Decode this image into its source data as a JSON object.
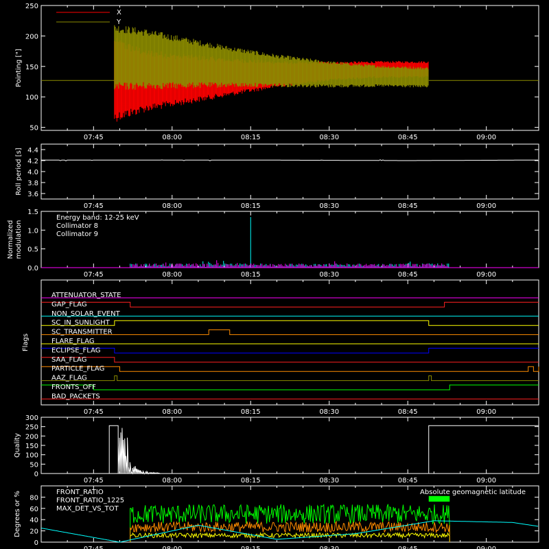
{
  "colors": {
    "background": "#000000",
    "axis": "#ffffff",
    "x": "#ff0000",
    "y": "#8c8c00",
    "white": "#ffffff",
    "cyan": "#00ffff",
    "magenta": "#ff00ff",
    "green": "#00ff00",
    "orange": "#ff8c00",
    "yellow": "#ffff00"
  },
  "time_axis": {
    "start": "07:35",
    "end": "09:10",
    "tick_labels": [
      "07:45",
      "08:00",
      "08:15",
      "08:30",
      "08:45",
      "09:00"
    ]
  },
  "chart_data": [
    {
      "id": "pointing",
      "type": "line",
      "ylabel": "Pointing [\"]",
      "ylim": [
        45,
        250
      ],
      "yticks": [
        50,
        100,
        150,
        200,
        250
      ],
      "grid": false,
      "legend_position": "top-left",
      "series": [
        {
          "name": "X",
          "color": "#ff0000",
          "x": [
            "07:49",
            "07:55",
            "08:00",
            "08:10",
            "08:20",
            "08:30",
            "08:40",
            "08:49"
          ],
          "center": [
            128,
            127,
            128,
            132,
            137,
            142,
            145,
            145
          ],
          "amplitude": [
            70,
            52,
            45,
            33,
            22,
            16,
            14,
            14
          ]
        },
        {
          "name": "Y",
          "color": "#8c8c00",
          "x": [
            "07:49",
            "07:55",
            "08:00",
            "08:10",
            "08:20",
            "08:30",
            "08:40",
            "08:49"
          ],
          "center": [
            165,
            162,
            158,
            150,
            143,
            137,
            134,
            132
          ],
          "amplitude": [
            55,
            50,
            45,
            35,
            27,
            22,
            18,
            17
          ]
        }
      ],
      "baseline_y": 127,
      "active_range": [
        "07:49",
        "08:49"
      ]
    },
    {
      "id": "roll_period",
      "type": "line",
      "ylabel": "Roll period [s]",
      "ylim": [
        3.5,
        4.5
      ],
      "yticks": [
        "3.6",
        "3.8",
        "4.0",
        "4.2",
        "4.4"
      ],
      "series": [
        {
          "x": [
            "07:35",
            "08:15",
            "08:45",
            "09:10"
          ],
          "y": [
            4.21,
            4.21,
            4.2,
            4.21
          ]
        }
      ]
    },
    {
      "id": "modulation",
      "type": "line",
      "ylabel": "Normalized modulation",
      "ylim": [
        0.0,
        1.5
      ],
      "yticks": [
        "0.0",
        "0.5",
        "1.0",
        "1.5"
      ],
      "legend": [
        "Energy band: 12-25 keV",
        "Collimator 8",
        "Collimator 9"
      ],
      "series": [
        {
          "name": "Collimator 8",
          "color": "#00ffff",
          "x_range": [
            "07:52",
            "08:53"
          ],
          "typical": 0.08,
          "spike": {
            "x": "08:15",
            "y": 1.35
          }
        },
        {
          "name": "Collimator 9",
          "color": "#ff00ff",
          "x_range": [
            "07:52",
            "08:53"
          ],
          "typical": 0.08
        }
      ]
    },
    {
      "id": "flags",
      "type": "line",
      "ylabel": "Flags",
      "series": [
        {
          "name": "ATTENUATOR_STATE",
          "color": "#ff00ff",
          "steps": []
        },
        {
          "name": "GAP_FLAG",
          "color": "#ff2020",
          "steps": [
            [
              "07:35",
              1
            ],
            [
              "07:52",
              0
            ],
            [
              "08:52",
              1
            ]
          ]
        },
        {
          "name": "NON_SOLAR_EVENT",
          "color": "#00ffff",
          "steps": []
        },
        {
          "name": "SC_IN_SUNLIGHT",
          "color": "#ffff00",
          "steps": [
            [
              "07:35",
              0
            ],
            [
              "07:49",
              1
            ],
            [
              "08:49",
              0
            ]
          ]
        },
        {
          "name": "SC_TRANSMITTER",
          "color": "#ff8c00",
          "steps": [
            [
              "07:35",
              0
            ],
            [
              "08:07",
              1
            ],
            [
              "08:11",
              0
            ]
          ]
        },
        {
          "name": "FLARE_FLAG",
          "color": "#ffff00",
          "steps": []
        },
        {
          "name": "ECLIPSE_FLAG",
          "color": "#0000ff",
          "steps": [
            [
              "07:35",
              1
            ],
            [
              "07:49",
              0
            ],
            [
              "08:49",
              1
            ]
          ]
        },
        {
          "name": "SAA_FLAG",
          "color": "#ff2020",
          "steps": [
            [
              "07:35",
              1
            ],
            [
              "07:49",
              0
            ]
          ]
        },
        {
          "name": "PARTICLE_FLAG",
          "color": "#ff8c00",
          "steps": [
            [
              "07:35",
              1
            ],
            [
              "07:50",
              0
            ],
            [
              "09:08",
              1
            ],
            [
              "09:09",
              0
            ],
            [
              "09:10",
              1
            ]
          ]
        },
        {
          "name": "AAZ_FLAG",
          "color": "#8c8c00",
          "steps": [
            [
              "07:35",
              0
            ],
            [
              "07:49",
              1
            ],
            [
              "07:49.5",
              0
            ],
            [
              "08:49",
              1
            ],
            [
              "08:49.5",
              0
            ]
          ]
        },
        {
          "name": "FRONTS_OFF",
          "color": "#00ff00",
          "steps": [
            [
              "07:35",
              1
            ],
            [
              "07:45",
              0
            ],
            [
              "08:53",
              1
            ]
          ]
        },
        {
          "name": "BAD_PACKETS",
          "color": "#ff2020",
          "steps": []
        }
      ]
    },
    {
      "id": "quality",
      "type": "line",
      "ylabel": "Quality",
      "ylim": [
        0,
        300
      ],
      "yticks": [
        0,
        50,
        100,
        150,
        200,
        250,
        300
      ],
      "series": [
        {
          "color": "#ffffff",
          "x": [
            "07:35",
            "07:48",
            "07:48",
            "07:51",
            "07:51",
            "07:53",
            "07:55",
            "07:58",
            "08:49",
            "08:49",
            "09:10"
          ],
          "y": [
            0,
            0,
            255,
            255,
            40,
            255,
            25,
            0,
            0,
            255,
            255
          ]
        }
      ]
    },
    {
      "id": "ratios",
      "type": "line",
      "ylabel": "Degrees or %",
      "ylim": [
        0,
        100
      ],
      "yticks": [
        0,
        20,
        40,
        60,
        80
      ],
      "legend": [
        "FRONT_RATIO",
        "FRONT_RATIO_1225",
        "MAX_DET_VS_TOT"
      ],
      "right_label": "Absolute geomagnetic latitude",
      "series": [
        {
          "name": "FRONT_RATIO",
          "color": "#ffff00",
          "x_range": [
            "07:52",
            "08:53"
          ],
          "typical": 12
        },
        {
          "name": "FRONT_RATIO_1225",
          "color": "#00ff00",
          "x_range": [
            "07:52",
            "08:53"
          ],
          "typical": 50
        },
        {
          "name": "MAX_DET_VS_TOT",
          "color": "#ff8c00",
          "x_range": [
            "07:52",
            "08:53"
          ],
          "typical": 27
        },
        {
          "name": "Absolute geomagnetic latitude",
          "color": "#00ffff",
          "x": [
            "07:35",
            "07:50",
            "08:05",
            "08:20",
            "08:35",
            "08:50",
            "09:05",
            "09:10"
          ],
          "y": [
            25,
            0,
            30,
            5,
            15,
            38,
            35,
            28
          ]
        }
      ]
    }
  ]
}
